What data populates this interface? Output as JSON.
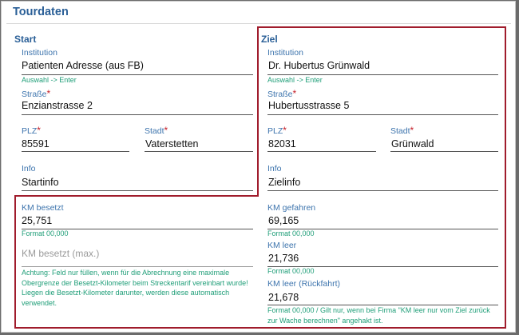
{
  "title": "Tourdaten",
  "start": {
    "heading": "Start",
    "institution_label": "Institution",
    "institution_value": "Patienten Adresse (aus FB)",
    "institution_hint": "Auswahl -> Enter",
    "street_label": "Straße",
    "street_value": "Enzianstrasse 2",
    "plz_label": "PLZ",
    "plz_value": "85591",
    "city_label": "Stadt",
    "city_value": "Vaterstetten",
    "info_label": "Info",
    "info_value": "Startinfo"
  },
  "ziel": {
    "heading": "Ziel",
    "institution_label": "Institution",
    "institution_value": "Dr. Hubertus Grünwald",
    "institution_hint": "Auswahl -> Enter",
    "street_label": "Straße",
    "street_value": "Hubertusstrasse 5",
    "plz_label": "PLZ",
    "plz_value": "82031",
    "city_label": "Stadt",
    "city_value": "Grünwald",
    "info_label": "Info",
    "info_value": "Zielinfo"
  },
  "km": {
    "besetzt_label": "KM besetzt",
    "besetzt_value": "25,751",
    "besetzt_hint": "Format 00,000",
    "besetzt_max_placeholder": "KM besetzt (max.)",
    "besetzt_max_note": "Achtung: Feld nur füllen, wenn für die Abrechnung eine maximale Obergrenze der Besetzt-Kilometer beim Streckentarif vereinbart wurde! Liegen die Besetzt-Kilometer darunter, werden diese automatisch verwendet.",
    "gefahren_label": "KM gefahren",
    "gefahren_value": "69,165",
    "gefahren_hint": "Format 00,000",
    "leer_label": "KM leer",
    "leer_value": "21,736",
    "leer_hint": "Format 00,000",
    "leer_rueck_label": "KM leer (Rückfahrt)",
    "leer_rueck_value": "21,678",
    "leer_rueck_hint": "Format 00,000 / Gilt nur, wenn bei Firma \"KM leer nur vom Ziel zurück zur Wache berechnen\" angehakt ist."
  },
  "required_mark": "*",
  "colors": {
    "accent": "#2a5f97",
    "label": "#3d74ad",
    "hint": "#1f9e78",
    "required": "#c41c26",
    "highlight_box": "#a01c2c"
  }
}
